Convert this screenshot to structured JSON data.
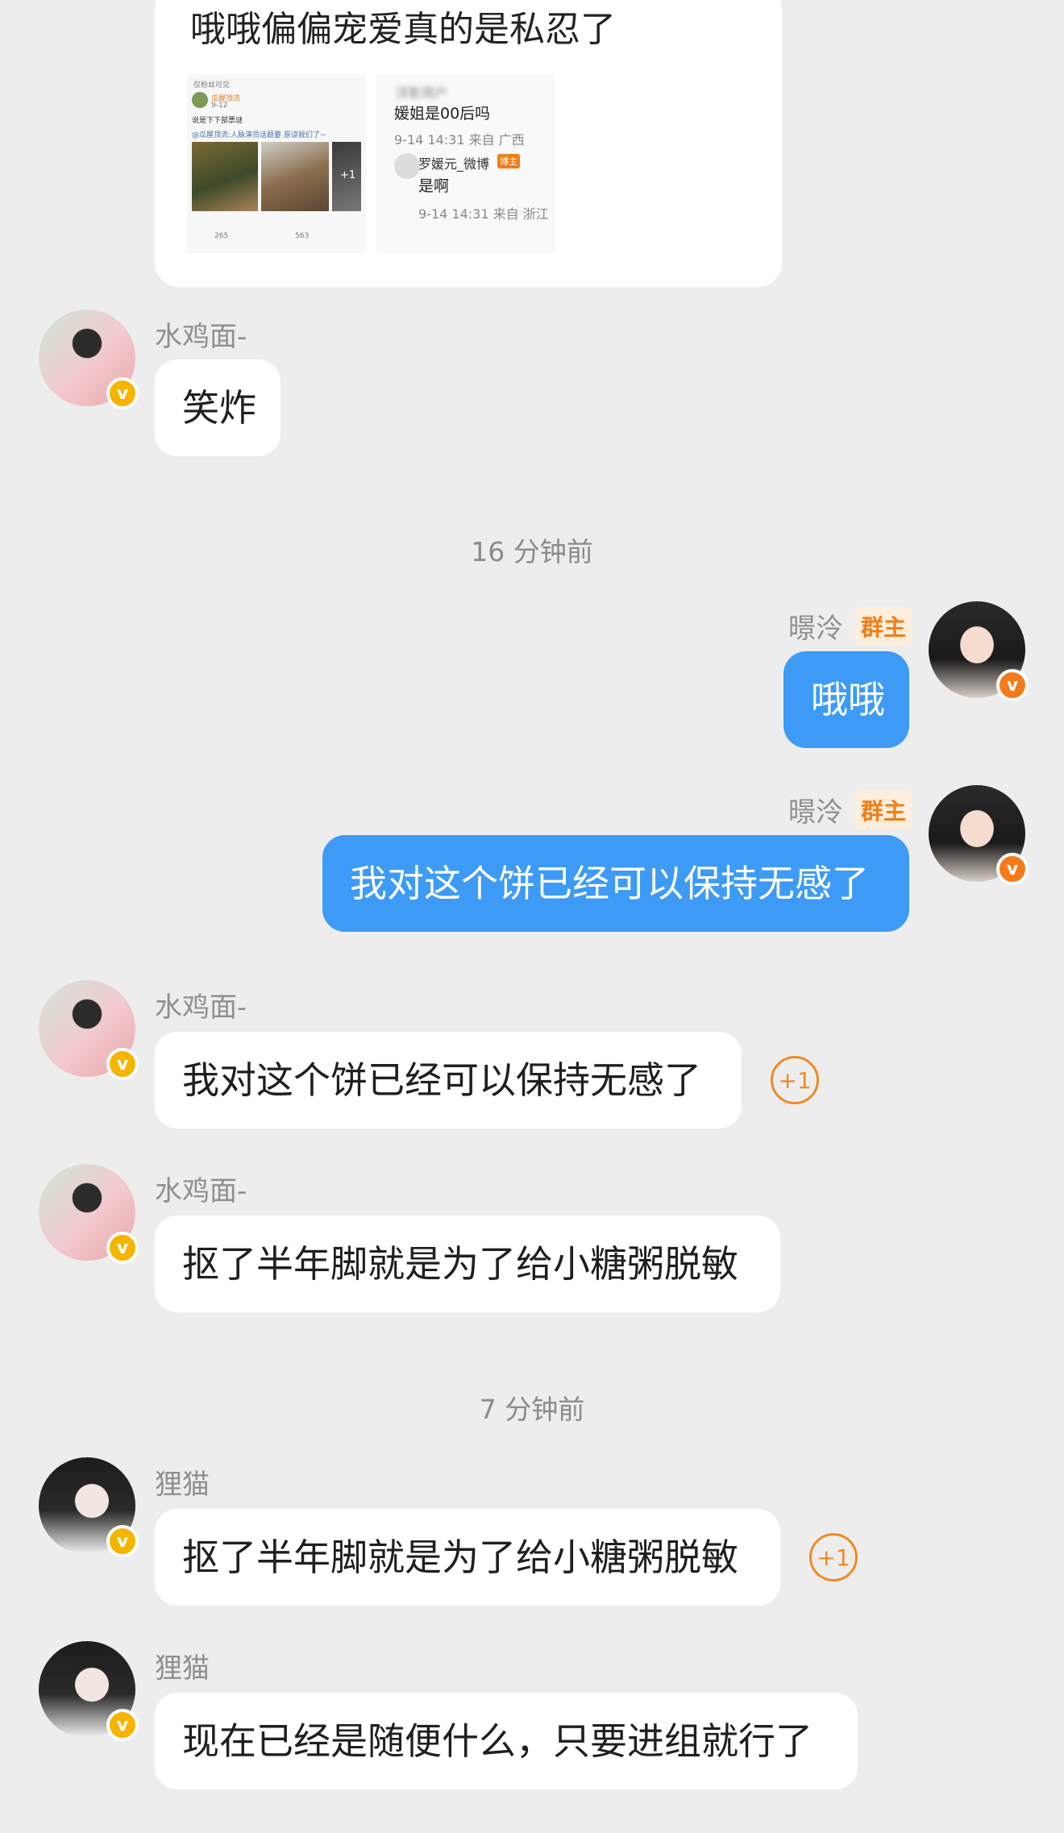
{
  "card": {
    "text": "哦哦偏偏宠爱真的是私忍了",
    "left_shot": {
      "visibility": "仅粉丝可见",
      "author": "瓜屋顶流",
      "date": "9-12",
      "line": "说是下下部票谜",
      "repost": "@瓜屋顶流:人脉演员话题要 原谅我们了~",
      "more": "+1",
      "comments": "265",
      "likes": "563"
    },
    "right_shot": {
      "user": "浮影用户",
      "question": "媛姐是00后吗",
      "q_meta": "9-14 14:31 来自 广西",
      "reply_user": "罗媛元_微博",
      "reply_badge": "博主",
      "reply_text": "是啊",
      "r_meta": "9-14 14:31 来自 浙江"
    }
  },
  "messages": {
    "m1": {
      "sender": "水鸡面-",
      "text": "笑炸"
    },
    "time1": "16 分钟前",
    "m2": {
      "sender": "暻泠",
      "badge": "群主",
      "text": "哦哦"
    },
    "m3": {
      "sender": "暻泠",
      "badge": "群主",
      "text": "我对这个饼已经可以保持无感了"
    },
    "m4": {
      "sender": "水鸡面-",
      "text": "我对这个饼已经可以保持无感了",
      "plus": "+1"
    },
    "m5": {
      "sender": "水鸡面-",
      "text": "抠了半年脚就是为了给小糖粥脱敏"
    },
    "time2": "7 分钟前",
    "m6": {
      "sender": "狸猫",
      "text": "抠了半年脚就是为了给小糖粥脱敏",
      "plus": "+1"
    },
    "m7": {
      "sender": "狸猫",
      "text": "现在已经是随便什么，只要进组就行了"
    }
  },
  "verified_mark": "v",
  "colors": {
    "self_bubble": "#3d9bf5",
    "other_bubble": "#ffffff",
    "owner_badge": "#f07e18",
    "background": "#ededed"
  }
}
